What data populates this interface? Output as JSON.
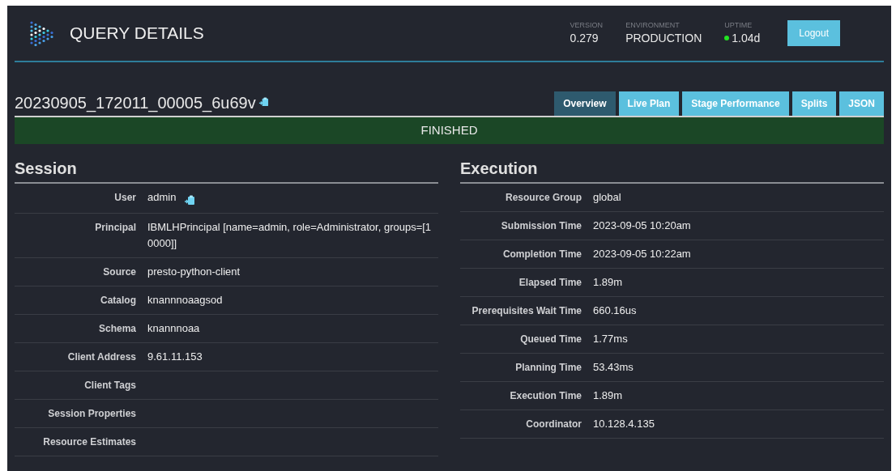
{
  "header": {
    "title": "QUERY DETAILS",
    "stats": [
      {
        "label": "VERSION",
        "value": "0.279",
        "kind": "plain"
      },
      {
        "label": "ENVIRONMENT",
        "value": "PRODUCTION",
        "kind": "plain"
      },
      {
        "label": "UPTIME",
        "value": "1.04d",
        "kind": "uptime"
      }
    ],
    "logout": "Logout"
  },
  "query": {
    "id": "20230905_172011_00005_6u69v",
    "tabs": [
      {
        "label": "Overview",
        "selected": true
      },
      {
        "label": "Live Plan",
        "selected": false
      },
      {
        "label": "Stage Performance",
        "selected": false
      },
      {
        "label": "Splits",
        "selected": false
      },
      {
        "label": "JSON",
        "selected": false
      }
    ],
    "state": "FINISHED"
  },
  "sections": [
    {
      "title": "Session",
      "rows": [
        {
          "label": "User",
          "value": "admin",
          "copyable": true
        },
        {
          "label": "Principal",
          "value": "IBMLHPrincipal [name=admin, role=Administrator, groups=[10000]]",
          "copyable": false
        },
        {
          "label": "Source",
          "value": "presto-python-client",
          "copyable": false
        },
        {
          "label": "Catalog",
          "value": "knannnoaagsod",
          "copyable": false
        },
        {
          "label": "Schema",
          "value": "knannnoaa",
          "copyable": false
        },
        {
          "label": "Client Address",
          "value": "9.61.11.153",
          "copyable": false
        },
        {
          "label": "Client Tags",
          "copyable": false
        },
        {
          "label": "Session Properties",
          "copyable": false
        },
        {
          "label": "Resource Estimates",
          "copyable": false
        }
      ]
    },
    {
      "title": "Execution",
      "rows": [
        {
          "label": "Resource Group",
          "value": "global",
          "copyable": false
        },
        {
          "label": "Submission Time",
          "value": "2023-09-05 10:20am",
          "copyable": false
        },
        {
          "label": "Completion Time",
          "value": "2023-09-05 10:22am",
          "copyable": false
        },
        {
          "label": "Elapsed Time",
          "value": "1.89m",
          "copyable": false
        },
        {
          "label": "Prerequisites Wait Time",
          "value": "660.16us",
          "copyable": false
        },
        {
          "label": "Queued Time",
          "value": "1.77ms",
          "copyable": false
        },
        {
          "label": "Planning Time",
          "value": "53.43ms",
          "copyable": false
        },
        {
          "label": "Execution Time",
          "value": "1.89m",
          "copyable": false
        },
        {
          "label": "Coordinator",
          "value": "10.128.4.135",
          "copyable": false
        }
      ]
    }
  ]
}
